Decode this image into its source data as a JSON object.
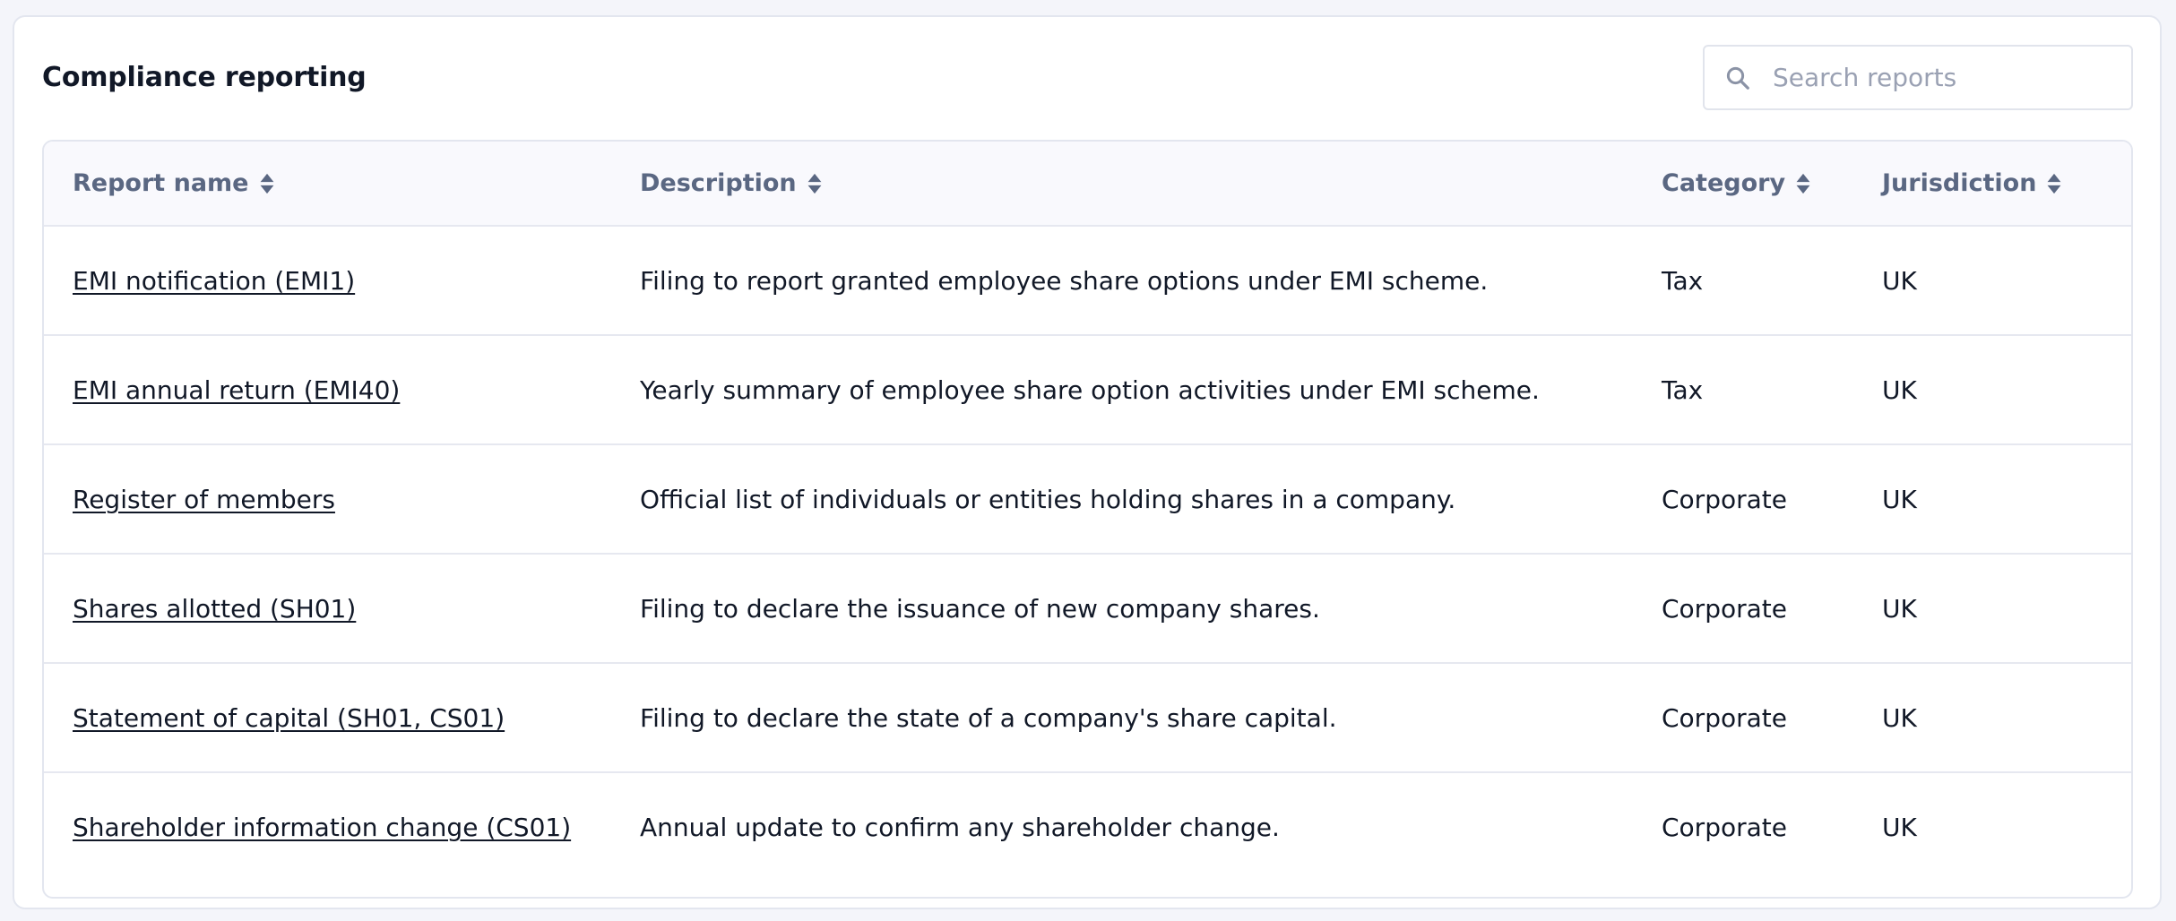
{
  "page": {
    "title": "Compliance reporting"
  },
  "search": {
    "placeholder": "Search reports",
    "value": "",
    "icon": "search-icon"
  },
  "table": {
    "columns": [
      {
        "label": "Report name",
        "sortable": true
      },
      {
        "label": "Description",
        "sortable": true
      },
      {
        "label": "Category",
        "sortable": true
      },
      {
        "label": "Jurisdiction",
        "sortable": true
      }
    ],
    "rows": [
      {
        "name": "EMI notification (EMI1)",
        "description": "Filing to report granted employee share options under EMI scheme.",
        "category": "Tax",
        "jurisdiction": "UK"
      },
      {
        "name": "EMI annual return (EMI40)",
        "description": "Yearly summary of employee share option activities under EMI scheme.",
        "category": "Tax",
        "jurisdiction": "UK"
      },
      {
        "name": "Register of members",
        "description": "Official list of individuals or entities holding shares in a company.",
        "category": "Corporate",
        "jurisdiction": "UK"
      },
      {
        "name": "Shares allotted (SH01)",
        "description": "Filing to declare the issuance of new company shares.",
        "category": "Corporate",
        "jurisdiction": "UK"
      },
      {
        "name": "Statement of capital (SH01, CS01)",
        "description": "Filing to declare the state of a company's share capital.",
        "category": "Corporate",
        "jurisdiction": "UK"
      },
      {
        "name": "Shareholder information change (CS01)",
        "description": "Annual update to confirm any shareholder change.",
        "category": "Corporate",
        "jurisdiction": "UK"
      }
    ]
  },
  "colors": {
    "header_text": "#5a6782",
    "placeholder": "#9aa1b3",
    "border": "#e3e6ef",
    "background": "#f4f5fa"
  }
}
